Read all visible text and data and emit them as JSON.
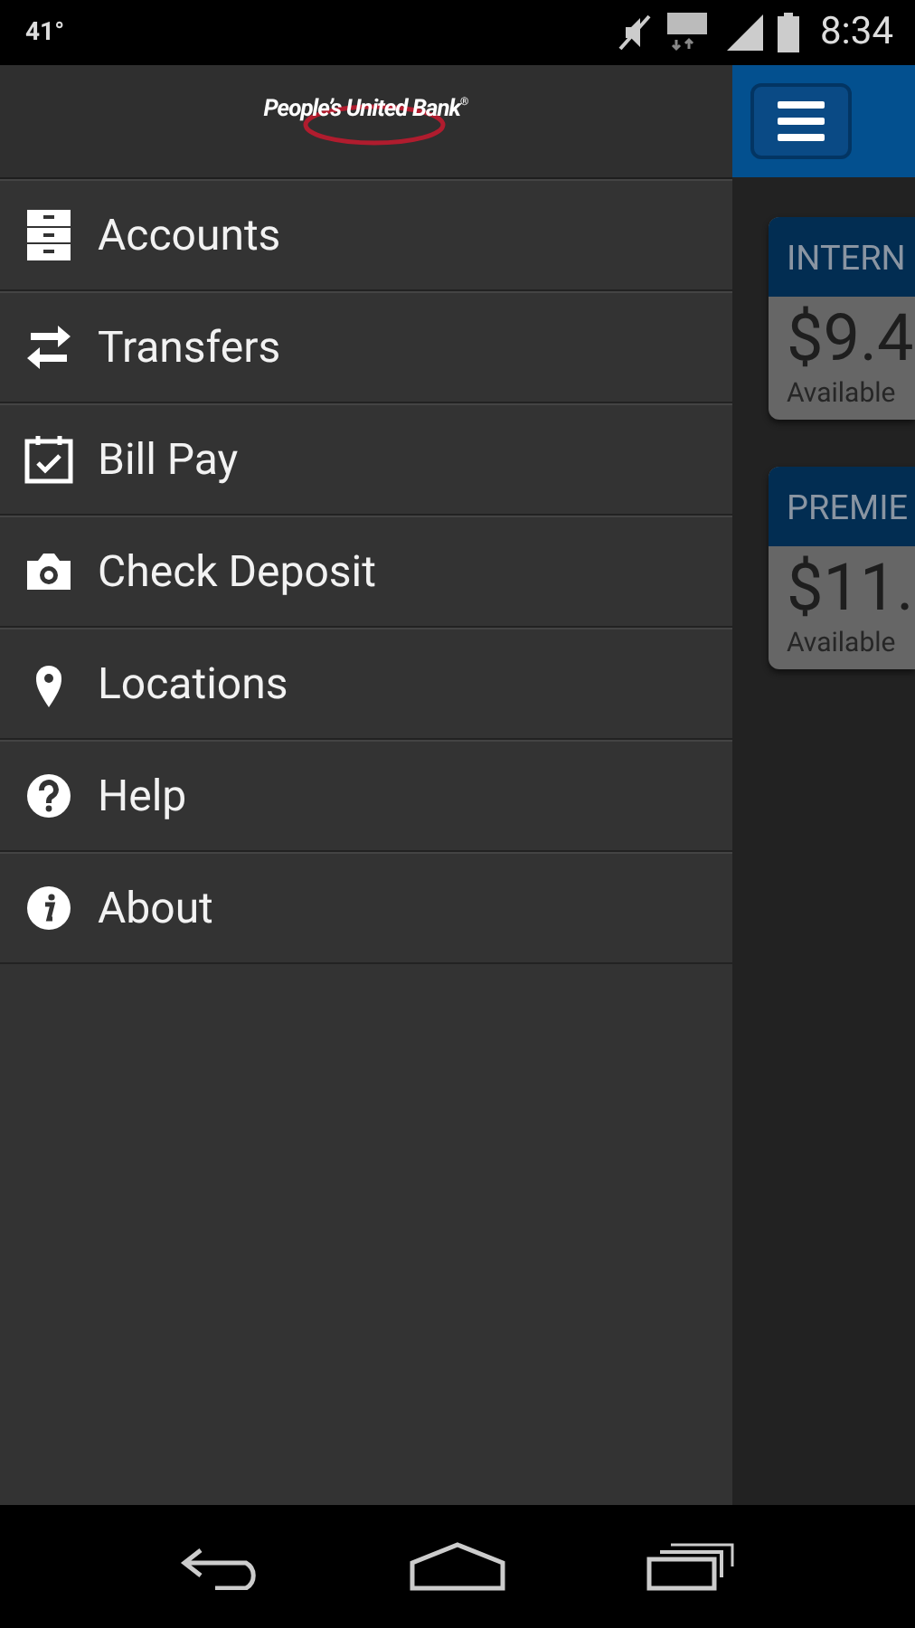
{
  "status_bar": {
    "temperature": "41°",
    "time": "8:34"
  },
  "drawer": {
    "logo": "People’s United Bank",
    "logo_mark": "®",
    "items": [
      {
        "label": "Accounts",
        "kind": "cabinet"
      },
      {
        "label": "Transfers",
        "kind": "arrows"
      },
      {
        "label": "Bill Pay",
        "kind": "calendar"
      },
      {
        "label": "Check Deposit",
        "kind": "camera"
      },
      {
        "label": "Locations",
        "kind": "pin"
      },
      {
        "label": "Help",
        "kind": "help"
      },
      {
        "label": "About",
        "kind": "info"
      }
    ]
  },
  "accounts": [
    {
      "name": "INTERN",
      "balance": "$9.4",
      "caption": "Available"
    },
    {
      "name": "PREMIE",
      "balance": "$11.",
      "caption": "Available"
    }
  ]
}
